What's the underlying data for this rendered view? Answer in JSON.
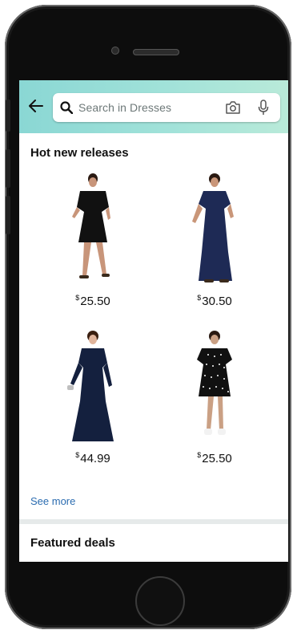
{
  "search": {
    "placeholder": "Search in Dresses"
  },
  "hot_new_releases": {
    "title": "Hot new releases",
    "products": [
      {
        "price_symbol": "$",
        "price": "25.50"
      },
      {
        "price_symbol": "$",
        "price": "30.50"
      },
      {
        "price_symbol": "$",
        "price": "44.99"
      },
      {
        "price_symbol": "$",
        "price": "25.50"
      }
    ],
    "see_more": "See more"
  },
  "featured_deals": {
    "title": "Featured deals"
  },
  "colors": {
    "header_start": "#8ad7d4",
    "header_end": "#b9ead9",
    "link": "#2b6cb0"
  }
}
